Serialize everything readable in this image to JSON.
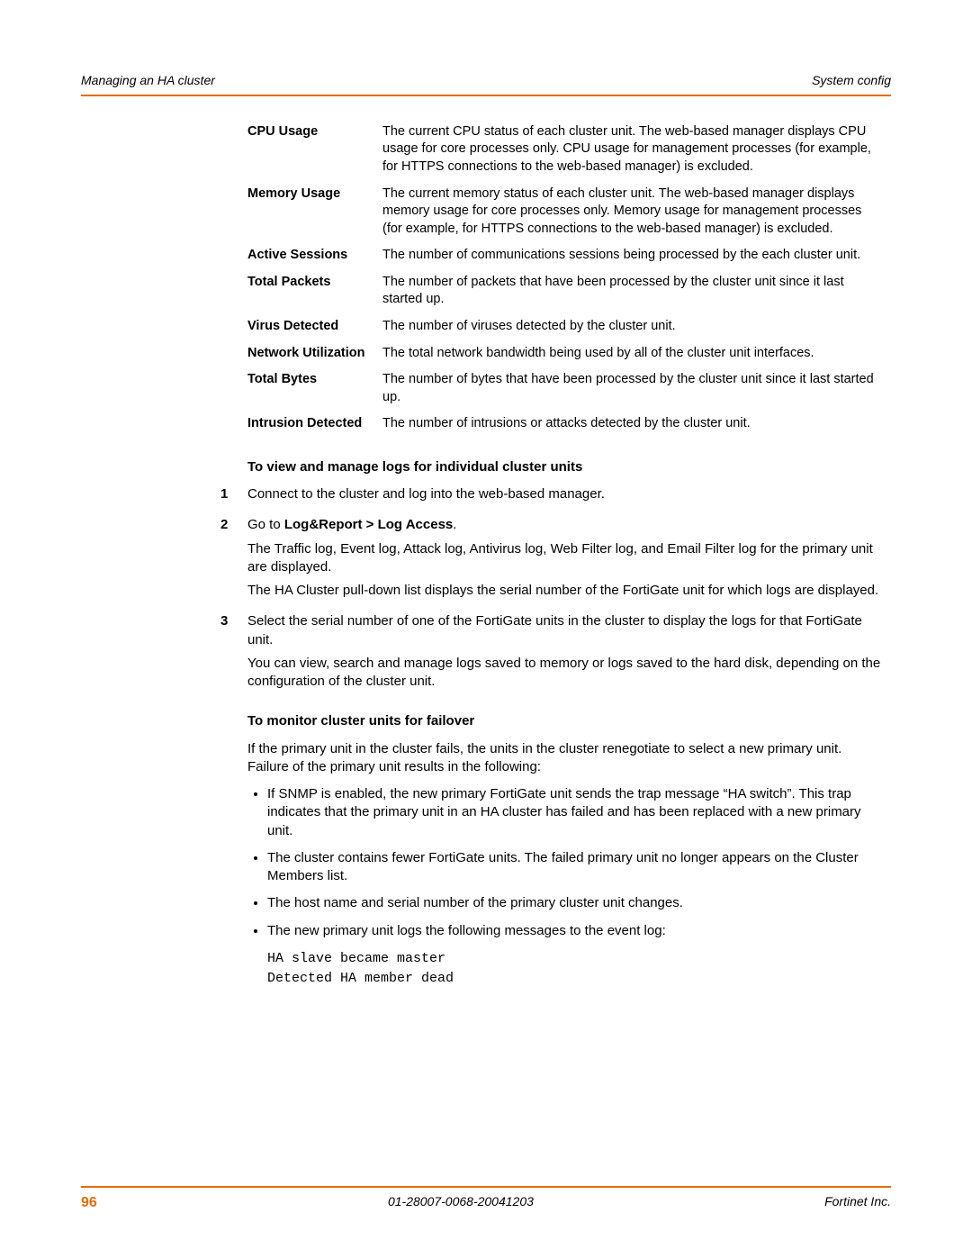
{
  "header": {
    "left": "Managing an HA cluster",
    "right": "System config"
  },
  "defs": [
    {
      "term": "CPU Usage",
      "desc": "The current CPU status of each cluster unit. The web-based manager displays CPU usage for core processes only. CPU usage for management processes (for example, for HTTPS connections to the web-based manager) is excluded."
    },
    {
      "term": "Memory Usage",
      "desc": "The current memory status of each cluster unit. The web-based manager displays memory usage for core processes only. Memory usage for management processes (for example, for HTTPS connections to the web-based manager) is excluded."
    },
    {
      "term": "Active Sessions",
      "desc": "The number of communications sessions being processed by the each cluster unit."
    },
    {
      "term": "Total Packets",
      "desc": "The number of packets that have been processed by the cluster unit since it last started up."
    },
    {
      "term": "Virus Detected",
      "desc": "The number of viruses detected by the cluster unit."
    },
    {
      "term": "Network Utilization",
      "desc": "The total network bandwidth being used by all of the cluster unit interfaces."
    },
    {
      "term": "Total Bytes",
      "desc": "The number of bytes that have been processed by the cluster unit since it last started up."
    },
    {
      "term": "Intrusion Detected",
      "desc": "The number of intrusions or attacks detected by the cluster unit."
    }
  ],
  "section1": {
    "title": "To view and manage logs for individual cluster units",
    "steps": {
      "s1": {
        "num": "1",
        "text": "Connect to the cluster and log into the web-based manager."
      },
      "s2": {
        "num": "2",
        "lead": "Go to ",
        "boldpath": "Log&Report > Log Access",
        "trail": ".",
        "p1": "The Traffic log, Event log, Attack log, Antivirus log, Web Filter log, and Email Filter log for the primary unit are displayed.",
        "p2": "The HA Cluster pull-down list displays the serial number of the FortiGate unit for which logs are displayed."
      },
      "s3": {
        "num": "3",
        "p1": "Select the serial number of one of the FortiGate units in the cluster to display the logs for that FortiGate unit.",
        "p2": "You can view, search and manage logs saved to memory or logs saved to the hard disk, depending on the configuration of the cluster unit."
      }
    }
  },
  "section2": {
    "title": "To monitor cluster units for failover",
    "intro": "If the primary unit in the cluster fails, the units in the cluster renegotiate to select a new primary unit. Failure of the primary unit results in the following:",
    "bullets": {
      "b1": "If SNMP is enabled, the new primary FortiGate unit sends the trap message “HA switch”. This trap indicates that the primary unit in an HA cluster has failed and has been replaced with a new primary unit.",
      "b2": "The cluster contains fewer FortiGate units. The failed primary unit no longer appears on the Cluster Members list.",
      "b3": "The host name and serial number of the primary cluster unit changes.",
      "b4": "The new primary unit logs the following messages to the event log:"
    },
    "code": {
      "l1": "HA slave became master",
      "l2": "Detected HA member dead"
    }
  },
  "footer": {
    "page": "96",
    "docid": "01-28007-0068-20041203",
    "company": "Fortinet Inc."
  }
}
